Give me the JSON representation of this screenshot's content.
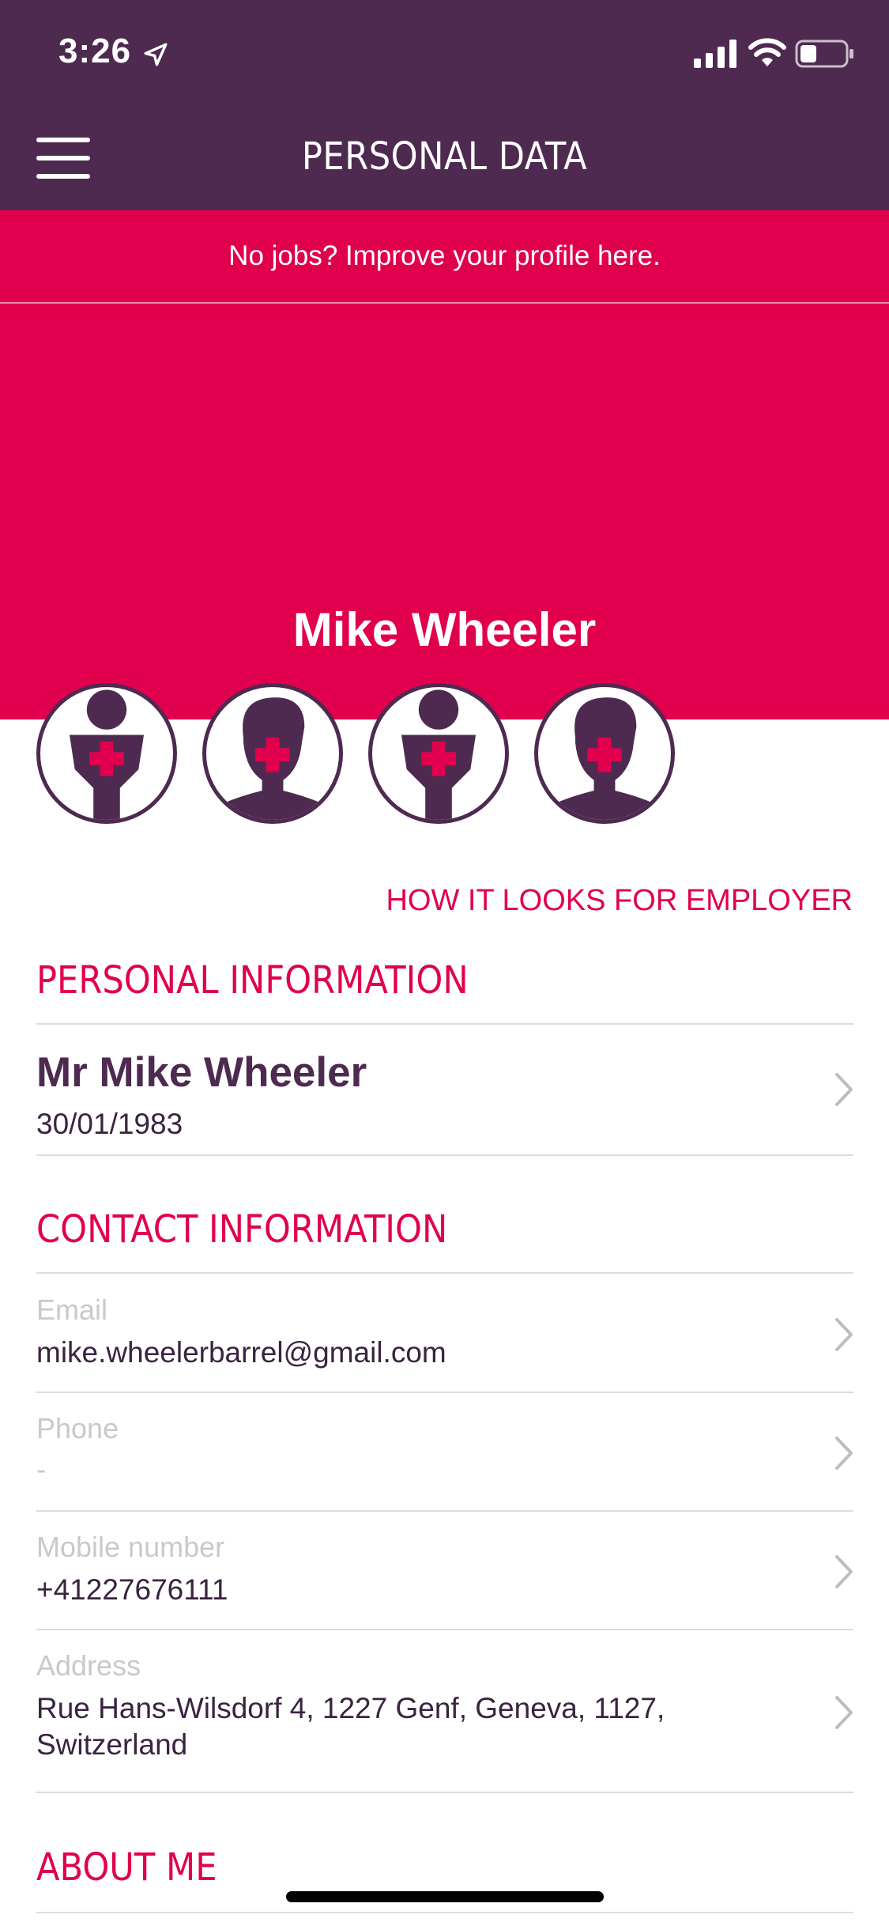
{
  "status_bar": {
    "time": "3:26"
  },
  "nav": {
    "title": "PERSONAL DATA"
  },
  "banner": {
    "text": "No jobs? Improve your profile here."
  },
  "hero": {
    "name": "Mike Wheeler"
  },
  "avatars": [
    "female-nurse-avatar",
    "male-nurse-avatar",
    "female-nurse-avatar",
    "male-nurse-avatar"
  ],
  "employer_link": "HOW IT LOOKS FOR EMPLOYER",
  "personal": {
    "title": "PERSONAL INFORMATION",
    "full_name": "Mr Mike Wheeler",
    "dob": "30/01/1983"
  },
  "contact": {
    "title": "CONTACT INFORMATION",
    "email_label": "Email",
    "email_value": "mike.wheelerbarrel@gmail.com",
    "phone_label": "Phone",
    "phone_value": "-",
    "mobile_label": "Mobile number",
    "mobile_value": "+41227676111",
    "address_label": "Address",
    "address_line1": "Rue Hans-Wilsdorf 4, 1227 Genf, Geneva, 1127,",
    "address_line2": "Switzerland"
  },
  "about": {
    "title": "ABOUT ME"
  },
  "colors": {
    "primary": "#4e2a51",
    "accent": "#e1004d"
  }
}
